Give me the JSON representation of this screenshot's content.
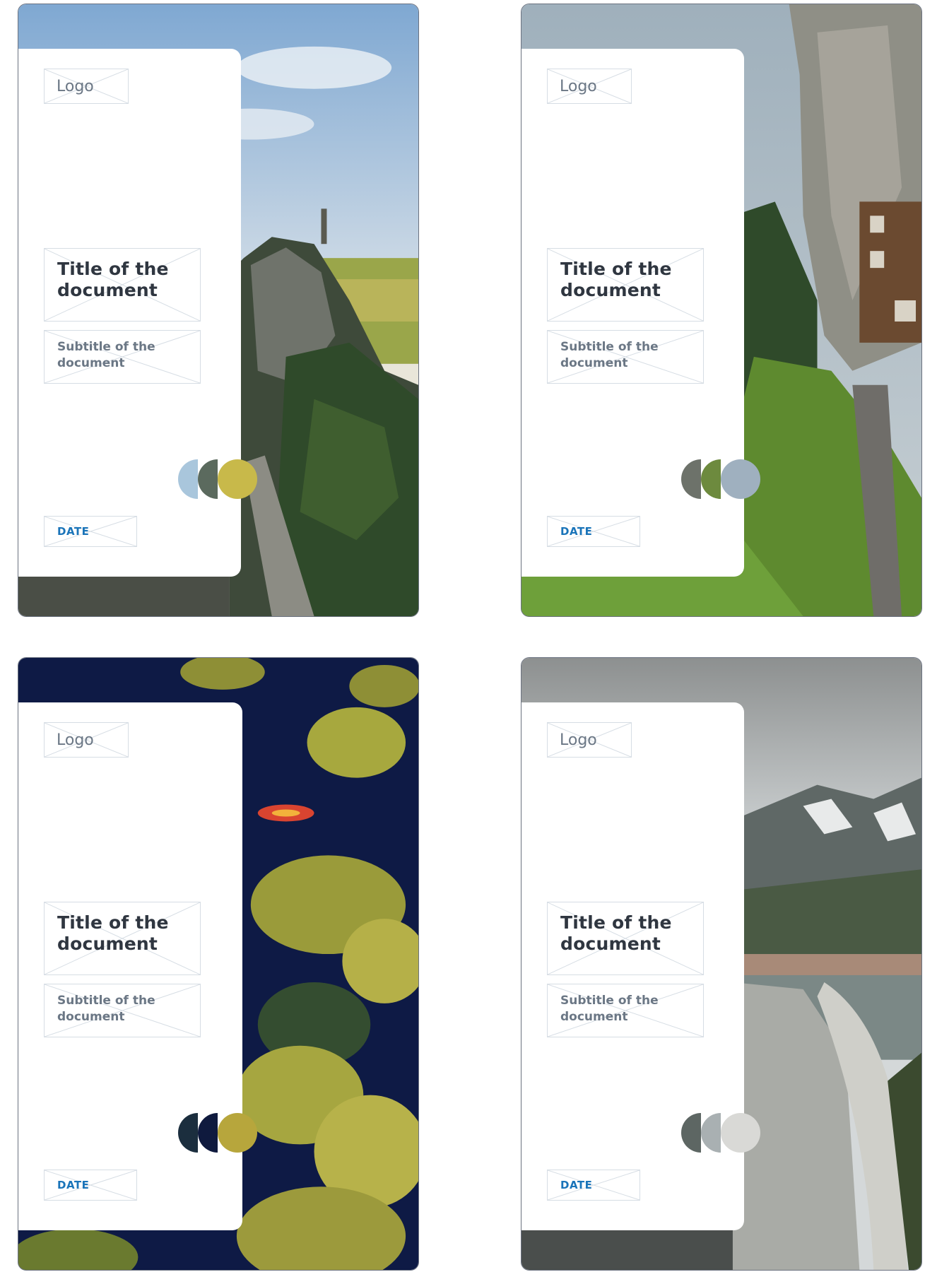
{
  "cards": [
    {
      "logo": "Logo",
      "title_line1": "Title of the",
      "title_line2": "document",
      "subtitle_line1": "Subtitle of the",
      "subtitle_line2": "document",
      "date": "DATE",
      "scene": "pagoda-cliff",
      "swatch_colors": [
        "#a9c6dc",
        "#5b6a5e",
        "#c8b94a"
      ]
    },
    {
      "logo": "Logo",
      "title_line1": "Title of the",
      "title_line2": "document",
      "subtitle_line1": "Subtitle of the",
      "subtitle_line2": "document",
      "date": "DATE",
      "scene": "cliff-house",
      "swatch_colors": [
        "#6d726a",
        "#6d8a3e",
        "#9fb0bf"
      ]
    },
    {
      "logo": "Logo",
      "title_line1": "Title of the",
      "title_line2": "document",
      "subtitle_line1": "Subtitle of the",
      "subtitle_line2": "document",
      "date": "DATE",
      "scene": "kayak-river",
      "swatch_colors": [
        "#1b2e3e",
        "#0f1a3e",
        "#b7a63c"
      ]
    },
    {
      "logo": "Logo",
      "title_line1": "Title of the",
      "title_line2": "document",
      "subtitle_line1": "Subtitle of the",
      "subtitle_line2": "document",
      "date": "DATE",
      "scene": "mountain-dam",
      "swatch_colors": [
        "#5d6663",
        "#a9b0b2",
        "#d9d9d6"
      ]
    }
  ]
}
